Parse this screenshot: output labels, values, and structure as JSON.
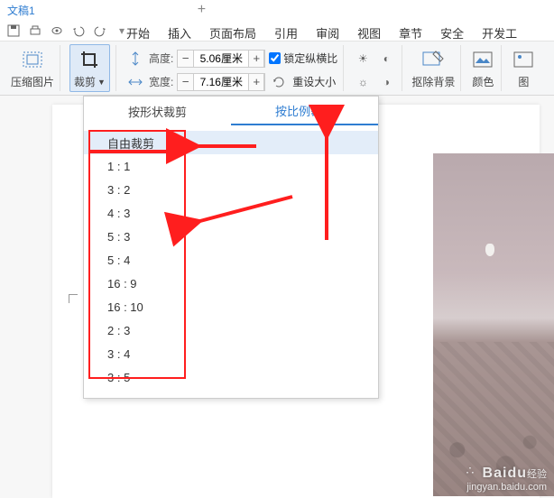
{
  "titlebar": {
    "doc": "文稿1"
  },
  "tabs": {
    "items": [
      "开始",
      "插入",
      "页面布局",
      "引用",
      "审阅",
      "视图",
      "章节",
      "安全",
      "开发工"
    ]
  },
  "ribbon": {
    "compress_label": "压缩图片",
    "crop_label": "裁剪",
    "height_label": "高度:",
    "width_label": "宽度:",
    "height_value": "5.06厘米",
    "width_value": "7.16厘米",
    "lock_ratio": "锁定纵横比",
    "reset_size": "重设大小",
    "remove_bg": "抠除背景",
    "color": "颜色",
    "pic": "图"
  },
  "dropdown": {
    "tab_shape": "按形状裁剪",
    "tab_ratio": "按比例裁剪",
    "ratios": [
      "自由裁剪",
      "1 : 1",
      "3 : 2",
      "4 : 3",
      "5 : 3",
      "5 : 4",
      "16 : 9",
      "16 : 10",
      "2 : 3",
      "3 : 4",
      "3 : 5"
    ]
  },
  "watermark": {
    "brand": "Baidu",
    "sub": "经验",
    "url": "jingyan.baidu.com"
  }
}
